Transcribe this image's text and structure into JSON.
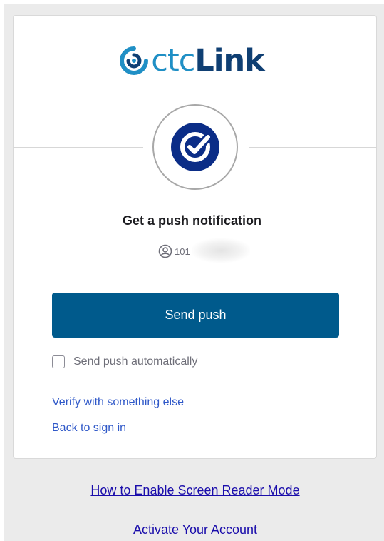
{
  "brand": {
    "name_part1": "ctc",
    "name_part2": "Link",
    "color_primary": "#1f8fc5",
    "color_dark": "#0f3f73"
  },
  "factor": {
    "icon": "okta-verify-check-icon",
    "title": "Get a push notification",
    "identifier_icon": "user-circle-icon",
    "identifier_visible": "101"
  },
  "actions": {
    "send_push_label": "Send push",
    "send_push_color": "#005a8c",
    "auto_push_label": "Send push automatically",
    "auto_push_checked": false
  },
  "links": {
    "verify_else": "Verify with something else",
    "back_to_signin": "Back to sign in"
  },
  "footer": {
    "screen_reader": "How to Enable Screen Reader Mode",
    "activate": "Activate Your Account"
  }
}
